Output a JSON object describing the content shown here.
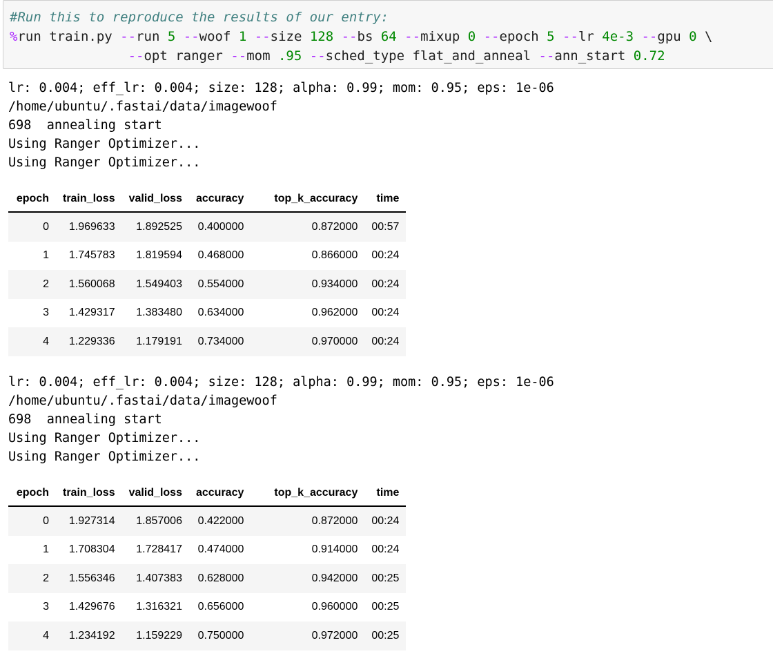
{
  "code_cell": {
    "comment": "#Run this to reproduce the results of our entry:",
    "line2": [
      {
        "t": "mg",
        "v": "%"
      },
      {
        "t": "tx",
        "v": "run train.py "
      },
      {
        "t": "op",
        "v": "--"
      },
      {
        "t": "tx",
        "v": "run "
      },
      {
        "t": "nm",
        "v": "5"
      },
      {
        "t": "tx",
        "v": " "
      },
      {
        "t": "op",
        "v": "--"
      },
      {
        "t": "tx",
        "v": "woof "
      },
      {
        "t": "nm",
        "v": "1"
      },
      {
        "t": "tx",
        "v": " "
      },
      {
        "t": "op",
        "v": "--"
      },
      {
        "t": "tx",
        "v": "size "
      },
      {
        "t": "nm",
        "v": "128"
      },
      {
        "t": "tx",
        "v": " "
      },
      {
        "t": "op",
        "v": "--"
      },
      {
        "t": "tx",
        "v": "bs "
      },
      {
        "t": "nm",
        "v": "64"
      },
      {
        "t": "tx",
        "v": " "
      },
      {
        "t": "op",
        "v": "--"
      },
      {
        "t": "tx",
        "v": "mixup "
      },
      {
        "t": "nm",
        "v": "0"
      },
      {
        "t": "tx",
        "v": " "
      },
      {
        "t": "op",
        "v": "--"
      },
      {
        "t": "tx",
        "v": "epoch "
      },
      {
        "t": "nm",
        "v": "5"
      },
      {
        "t": "tx",
        "v": " "
      },
      {
        "t": "op",
        "v": "--"
      },
      {
        "t": "tx",
        "v": "lr "
      },
      {
        "t": "nm",
        "v": "4e-3"
      },
      {
        "t": "tx",
        "v": " "
      },
      {
        "t": "op",
        "v": "--"
      },
      {
        "t": "tx",
        "v": "gpu "
      },
      {
        "t": "nm",
        "v": "0"
      },
      {
        "t": "tx",
        "v": " \\"
      }
    ],
    "line3": [
      {
        "t": "tx",
        "v": "               "
      },
      {
        "t": "op",
        "v": "--"
      },
      {
        "t": "tx",
        "v": "opt ranger "
      },
      {
        "t": "op",
        "v": "--"
      },
      {
        "t": "tx",
        "v": "mom "
      },
      {
        "t": "nm",
        "v": ".95"
      },
      {
        "t": "tx",
        "v": " "
      },
      {
        "t": "op",
        "v": "--"
      },
      {
        "t": "tx",
        "v": "sched_type flat_and_anneal "
      },
      {
        "t": "op",
        "v": "--"
      },
      {
        "t": "tx",
        "v": "ann_start "
      },
      {
        "t": "nm",
        "v": "0.72"
      }
    ]
  },
  "runs": [
    {
      "log": [
        "lr: 0.004; eff_lr: 0.004; size: 128; alpha: 0.99; mom: 0.95; eps: 1e-06",
        "/home/ubuntu/.fastai/data/imagewoof",
        "698  annealing start",
        "Using Ranger Optimizer...",
        "Using Ranger Optimizer..."
      ],
      "columns": [
        "epoch",
        "train_loss",
        "valid_loss",
        "accuracy",
        "top_k_accuracy",
        "time"
      ],
      "rows": [
        [
          "0",
          "1.969633",
          "1.892525",
          "0.400000",
          "0.872000",
          "00:57"
        ],
        [
          "1",
          "1.745783",
          "1.819594",
          "0.468000",
          "0.866000",
          "00:24"
        ],
        [
          "2",
          "1.560068",
          "1.549403",
          "0.554000",
          "0.934000",
          "00:24"
        ],
        [
          "3",
          "1.429317",
          "1.383480",
          "0.634000",
          "0.962000",
          "00:24"
        ],
        [
          "4",
          "1.229336",
          "1.179191",
          "0.734000",
          "0.970000",
          "00:24"
        ]
      ]
    },
    {
      "log": [
        "lr: 0.004; eff_lr: 0.004; size: 128; alpha: 0.99; mom: 0.95; eps: 1e-06",
        "/home/ubuntu/.fastai/data/imagewoof",
        "698  annealing start",
        "Using Ranger Optimizer...",
        "Using Ranger Optimizer..."
      ],
      "columns": [
        "epoch",
        "train_loss",
        "valid_loss",
        "accuracy",
        "top_k_accuracy",
        "time"
      ],
      "rows": [
        [
          "0",
          "1.927314",
          "1.857006",
          "0.422000",
          "0.872000",
          "00:24"
        ],
        [
          "1",
          "1.708304",
          "1.728417",
          "0.474000",
          "0.914000",
          "00:24"
        ],
        [
          "2",
          "1.556346",
          "1.407383",
          "0.628000",
          "0.942000",
          "00:25"
        ],
        [
          "3",
          "1.429676",
          "1.316321",
          "0.656000",
          "0.960000",
          "00:25"
        ],
        [
          "4",
          "1.234192",
          "1.159229",
          "0.750000",
          "0.972000",
          "00:25"
        ]
      ]
    }
  ],
  "colors": {
    "comment": "#408080",
    "magic_and_operator": "#aa22ff",
    "number": "#008800",
    "cell_background": "#f7f7f7",
    "row_stripe": "#f5f5f5"
  }
}
